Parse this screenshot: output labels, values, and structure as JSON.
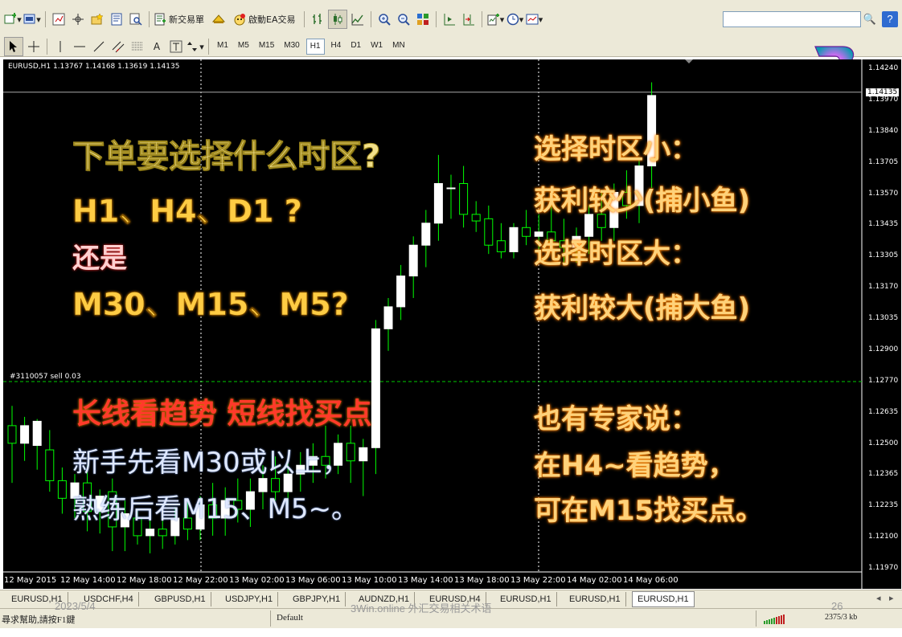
{
  "toolbar": {
    "new_order_label": "新交易單",
    "expert_label": "啟動EA交易",
    "periods": [
      "M1",
      "M5",
      "M15",
      "M30",
      "H1",
      "H4",
      "D1",
      "W1",
      "MN"
    ],
    "active_period": "H1"
  },
  "chart": {
    "header": "EURUSD,H1  1.13767 1.14168 1.13619 1.14135",
    "current_price": "1.14135",
    "order_label": "#3110057 sell 0.03",
    "price_scale": [
      "1.14240",
      "1.13970",
      "1.13840",
      "1.13705",
      "1.13570",
      "1.13435",
      "1.13305",
      "1.13170",
      "1.13035",
      "1.12900",
      "1.12770",
      "1.12635",
      "1.12500",
      "1.12365",
      "1.12235",
      "1.12100",
      "1.11970"
    ],
    "time_scale": [
      "12 May 2015",
      "12 May 14:00",
      "12 May 18:00",
      "12 May 22:00",
      "13 May 02:00",
      "13 May 06:00",
      "13 May 10:00",
      "13 May 14:00",
      "13 May 18:00",
      "13 May 22:00",
      "14 May 02:00",
      "14 May 06:00"
    ],
    "colors": {
      "background": "#000000",
      "bull": "#ffffff",
      "bear": "#000000",
      "wick": "#00ff00",
      "grid": "#ffffff",
      "order_line": "#00cc00"
    }
  },
  "overlay": {
    "question": "下单要选择什么时区?",
    "options_1": "H1、H4、D1 ?",
    "or": "还是",
    "options_2": "M30、M15、M5?",
    "small_tf": "选择时区小：",
    "small_profit": "获利较少(捕小鱼)",
    "large_tf": "选择时区大：",
    "large_profit": "获利较大(捕大鱼)",
    "motto": "长线看趋势 短线找买点",
    "novice_1": "新手先看M30或以上，",
    "novice_2": "熟练后看M15、M5~。",
    "expert_intro": "也有专家说：",
    "expert_1": "在H4~看趋势，",
    "expert_2": "可在M15找买点。"
  },
  "tabs": [
    "EURUSD,H1",
    "USDCHF,H4",
    "GBPUSD,H1",
    "USDJPY,H1",
    "GBPJPY,H1",
    "AUDNZD,H1",
    "EURUSD,H4",
    "EURUSD,H1",
    "EURUSD,H1",
    "EURUSD,H1"
  ],
  "active_tab": 9,
  "status": {
    "help": "尋求幫助,請按F1鍵",
    "profile": "Default",
    "traffic": "2375/3 kb"
  },
  "slide_footer": {
    "date": "2023/5/4",
    "title": "3Win.online 外汇交易相关术语",
    "page": "26"
  },
  "candles": [
    {
      "o": 1.1262,
      "h": 1.1271,
      "l": 1.1236,
      "c": 1.1254
    },
    {
      "o": 1.1254,
      "h": 1.1266,
      "l": 1.1246,
      "c": 1.1262
    },
    {
      "o": 1.1253,
      "h": 1.1265,
      "l": 1.1242,
      "c": 1.1264
    },
    {
      "o": 1.1251,
      "h": 1.126,
      "l": 1.1232,
      "c": 1.1237
    },
    {
      "o": 1.1237,
      "h": 1.1243,
      "l": 1.1222,
      "c": 1.1229
    },
    {
      "o": 1.1229,
      "h": 1.124,
      "l": 1.122,
      "c": 1.1236
    },
    {
      "o": 1.1236,
      "h": 1.1244,
      "l": 1.1214,
      "c": 1.1223
    },
    {
      "o": 1.1223,
      "h": 1.1233,
      "l": 1.1213,
      "c": 1.123
    },
    {
      "o": 1.1232,
      "h": 1.1238,
      "l": 1.1205,
      "c": 1.1216
    },
    {
      "o": 1.1216,
      "h": 1.1228,
      "l": 1.1205,
      "c": 1.1222
    },
    {
      "o": 1.122,
      "h": 1.1224,
      "l": 1.1208,
      "c": 1.1212
    },
    {
      "o": 1.1212,
      "h": 1.122,
      "l": 1.1204,
      "c": 1.1215
    },
    {
      "o": 1.1215,
      "h": 1.1226,
      "l": 1.1206,
      "c": 1.1212
    },
    {
      "o": 1.1212,
      "h": 1.1225,
      "l": 1.1208,
      "c": 1.122
    },
    {
      "o": 1.122,
      "h": 1.1228,
      "l": 1.121,
      "c": 1.1215
    },
    {
      "o": 1.1215,
      "h": 1.123,
      "l": 1.121,
      "c": 1.1226
    },
    {
      "o": 1.1226,
      "h": 1.1236,
      "l": 1.1212,
      "c": 1.122
    },
    {
      "o": 1.122,
      "h": 1.1234,
      "l": 1.1212,
      "c": 1.1228
    },
    {
      "o": 1.1228,
      "h": 1.1238,
      "l": 1.1218,
      "c": 1.1224
    },
    {
      "o": 1.1224,
      "h": 1.1238,
      "l": 1.1216,
      "c": 1.1232
    },
    {
      "o": 1.1232,
      "h": 1.1244,
      "l": 1.1224,
      "c": 1.1238
    },
    {
      "o": 1.1238,
      "h": 1.1248,
      "l": 1.1228,
      "c": 1.1232
    },
    {
      "o": 1.1232,
      "h": 1.1245,
      "l": 1.1226,
      "c": 1.124
    },
    {
      "o": 1.124,
      "h": 1.125,
      "l": 1.1232,
      "c": 1.1244
    },
    {
      "o": 1.1244,
      "h": 1.1254,
      "l": 1.1236,
      "c": 1.1248
    },
    {
      "o": 1.1248,
      "h": 1.1262,
      "l": 1.1238,
      "c": 1.1244
    },
    {
      "o": 1.1244,
      "h": 1.1258,
      "l": 1.124,
      "c": 1.1254
    },
    {
      "o": 1.1254,
      "h": 1.1262,
      "l": 1.1236,
      "c": 1.1246
    },
    {
      "o": 1.1246,
      "h": 1.1256,
      "l": 1.123,
      "c": 1.1252
    },
    {
      "o": 1.1252,
      "h": 1.131,
      "l": 1.124,
      "c": 1.1306
    },
    {
      "o": 1.1306,
      "h": 1.132,
      "l": 1.1296,
      "c": 1.1316
    },
    {
      "o": 1.1316,
      "h": 1.1335,
      "l": 1.131,
      "c": 1.133
    },
    {
      "o": 1.133,
      "h": 1.1348,
      "l": 1.132,
      "c": 1.1344
    },
    {
      "o": 1.1344,
      "h": 1.136,
      "l": 1.1334,
      "c": 1.1354
    },
    {
      "o": 1.1354,
      "h": 1.1385,
      "l": 1.1346,
      "c": 1.1372
    },
    {
      "o": 1.137,
      "h": 1.1376,
      "l": 1.1356,
      "c": 1.137
    },
    {
      "o": 1.1372,
      "h": 1.138,
      "l": 1.1352,
      "c": 1.1358
    },
    {
      "o": 1.1358,
      "h": 1.1364,
      "l": 1.135,
      "c": 1.1355
    },
    {
      "o": 1.1356,
      "h": 1.1362,
      "l": 1.134,
      "c": 1.1344
    },
    {
      "o": 1.1346,
      "h": 1.1354,
      "l": 1.1338,
      "c": 1.1341
    },
    {
      "o": 1.1341,
      "h": 1.1354,
      "l": 1.1338,
      "c": 1.1352
    },
    {
      "o": 1.1352,
      "h": 1.136,
      "l": 1.1344,
      "c": 1.1348
    },
    {
      "o": 1.1348,
      "h": 1.1358,
      "l": 1.134,
      "c": 1.135
    },
    {
      "o": 1.135,
      "h": 1.1362,
      "l": 1.1342,
      "c": 1.1346
    },
    {
      "o": 1.1346,
      "h": 1.1356,
      "l": 1.1336,
      "c": 1.1343
    },
    {
      "o": 1.1343,
      "h": 1.1352,
      "l": 1.1336,
      "c": 1.1348
    },
    {
      "o": 1.1348,
      "h": 1.1362,
      "l": 1.134,
      "c": 1.1358
    },
    {
      "o": 1.1358,
      "h": 1.1368,
      "l": 1.1346,
      "c": 1.1352
    },
    {
      "o": 1.1352,
      "h": 1.1372,
      "l": 1.1346,
      "c": 1.1368
    },
    {
      "o": 1.1368,
      "h": 1.1378,
      "l": 1.1356,
      "c": 1.1362
    },
    {
      "o": 1.1362,
      "h": 1.1384,
      "l": 1.1354,
      "c": 1.138
    },
    {
      "o": 1.138,
      "h": 1.1418,
      "l": 1.137,
      "c": 1.1412
    }
  ]
}
